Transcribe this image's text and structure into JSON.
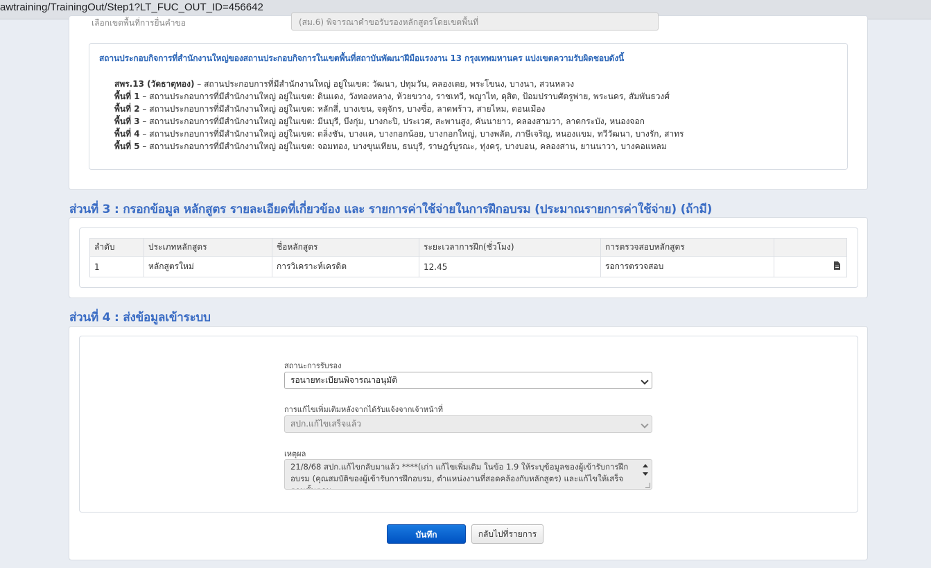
{
  "browser": {
    "url": "awtraining/TrainingOut/Step1?LT_FUC_OUT_ID=456642"
  },
  "top": {
    "label": "เลือกเขตพื้นที่การยื่นคำขอ",
    "select_value": "(สม.6) พิจารณาคำขอรับรองหลักสูตรโดยเขตพื้นที่"
  },
  "zones": {
    "title": "สถานประกอบกิจการที่สำนักงานใหญ่ของสถานประกอบกิจการในเขตพื้นที่สถาบันพัฒนาฝีมือแรงงาน 13 กรุงเทพมหานคร แบ่งเขตความรับผิดชอบดังนี้",
    "items": [
      {
        "name": "สพร.13 (วัดธาตุทอง)",
        "text": " – สถานประกอบการที่มีสำนักงานใหญ่ อยู่ในเขต: วัฒนา, ปทุมวัน, คลองเตย, พระโขนง, บางนา, สวนหลวง"
      },
      {
        "name": "พื้นที่ 1",
        "text": " – สถานประกอบการที่มีสำนักงานใหญ่ อยู่ในเขต: ดินแดง, วังทองหลาง, ห้วยขวาง, ราชเทวี, พญาไท, ดุสิต, ป้อมปราบศัตรูพ่าย, พระนคร, สัมพันธวงศ์"
      },
      {
        "name": "พื้นที่ 2",
        "text": " – สถานประกอบการที่มีสำนักงานใหญ่ อยู่ในเขต: หลักสี่, บางเขน, จตุจักร, บางซื่อ, ลาดพร้าว, สายไหม, ดอนเมือง"
      },
      {
        "name": "พื้นที่ 3",
        "text": " – สถานประกอบการที่มีสำนักงานใหญ่ อยู่ในเขต: มีนบุรี, บึงกุ่ม, บางกะปิ, ประเวศ, สะพานสูง, คันนายาว, คลองสามวา, ลาดกระบัง, หนองจอก"
      },
      {
        "name": "พื้นที่ 4",
        "text": " – สถานประกอบการที่มีสำนักงานใหญ่ อยู่ในเขต: ตลิ่งชัน, บางแค, บางกอกน้อย, บางกอกใหญ่, บางพลัด, ภาษีเจริญ, หนองแขม, ทวีวัฒนา, บางรัก, สาทร"
      },
      {
        "name": "พื้นที่ 5",
        "text": " – สถานประกอบการที่มีสำนักงานใหญ่ อยู่ในเขต: จอมทอง, บางขุนเทียน, ธนบุรี, ราษฎร์บูรณะ, ทุ่งครุ, บางบอน, คลองสาน, ยานนาวา, บางคอแหลม"
      }
    ]
  },
  "section3": {
    "heading": "ส่วนที่ 3 : กรอกข้อมูล หลักสูตร รายละเอียดที่เกี่ยวข้อง และ รายการค่าใช้จ่ายในการฝึกอบรม (ประมาณรายการค่าใช้จ่าย) (ถ้ามี)",
    "columns": [
      "ลำดับ",
      "ประเภทหลักสูตร",
      "ชื่อหลักสูตร",
      "ระยะเวลาการฝึก(ชั่วโมง)",
      "การตรวจสอบหลักสูตร",
      ""
    ],
    "rows": [
      [
        "1",
        "หลักสูตรใหม่",
        "การวิเคราะห์เครดิต",
        "12.45",
        "รอการตรวจสอบ"
      ]
    ]
  },
  "section4": {
    "heading": "ส่วนที่ 4 : ส่งข้อมูลเข้าระบบ",
    "status_label": "สถานะการรับรอง",
    "status_value": "รอนายทะเบียนพิจารณาอนุมัติ",
    "fix_label": "การแก้ไขเพิ่มเติมหลังจากได้รับแจ้งจากเจ้าหน้าที่",
    "fix_value": "สปก.แก้ไขเสร็จแล้ว",
    "reason_label": "เหตุผล",
    "reason_value": "21/8/68 สปก.แก้ไขกลับมาแล้ว ****(เก่า แก้ไขเพิ่มเติม ในข้อ 1.9 ให้ระบุข้อมูลของผู้เข้ารับการฝึกอบรม (คุณสมบัติของผู้เข้ารับการฝึกอบรม, ตำแหน่งงานที่สอดคล้องกับหลักสูตร)  และแก้ไขให้เสร็จตามขั้นตอน",
    "save_label": "บันทึก",
    "back_label": "กลับไปที่รายการ"
  }
}
